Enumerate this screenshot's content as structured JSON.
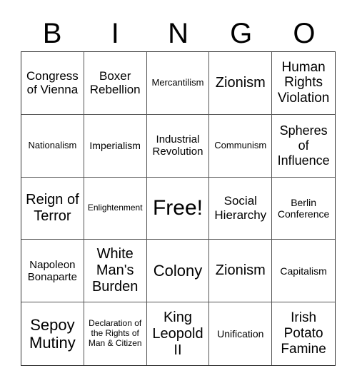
{
  "header": {
    "letters": [
      "B",
      "I",
      "N",
      "G",
      "O"
    ]
  },
  "cells": [
    "Congress of Vienna",
    "Boxer Rebellion",
    "Mercantilism",
    "Zionism",
    "Human Rights Violation",
    "Nationalism",
    "Imperialism",
    "Industrial Revolution",
    "Communism",
    "Spheres of Influence",
    "Reign of Terror",
    "Enlightenment",
    "Free!",
    "Social Hierarchy",
    "Berlin Conference",
    "Napoleon Bonaparte",
    "White Man's Burden",
    "Colony",
    "Zionism",
    "Capitalism",
    "Sepoy Mutiny",
    "Declaration of the Rights of Man & Citizen",
    "King Leopold II",
    "Unification",
    "Irish Potato Famine"
  ]
}
